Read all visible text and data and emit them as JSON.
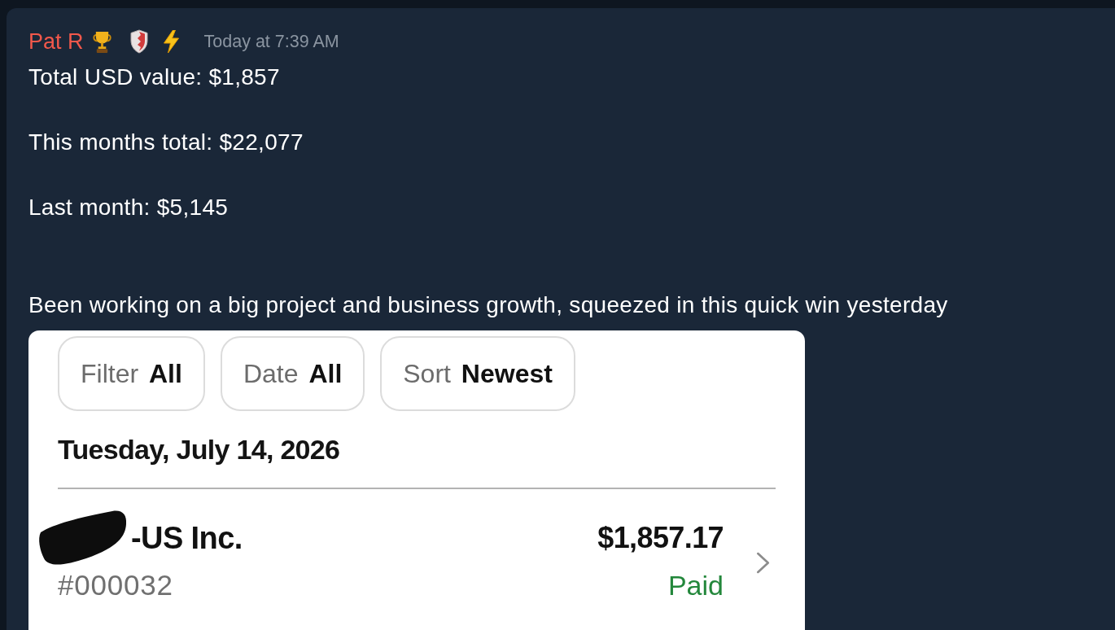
{
  "message": {
    "author": "Pat R",
    "badges": [
      {
        "kind": "trophy"
      },
      {
        "kind": "shield"
      },
      {
        "kind": "lightning"
      }
    ],
    "timestamp": "Today at 7:39 AM",
    "text": "Total USD value: $1,857\n\nThis months total: $22,077\n\nLast month: $5,145\n\n\nBeen working on a big project and business growth, squeezed in this quick win yesterday"
  },
  "attachment": {
    "chips": [
      {
        "label": "Filter",
        "value": "All"
      },
      {
        "label": "Date",
        "value": "All"
      },
      {
        "label": "Sort",
        "value": "Newest"
      }
    ],
    "date_heading": "Tuesday, July 14, 2026",
    "transactions": [
      {
        "payee": "-US Inc.",
        "payee_redacted": true,
        "number": "#000032",
        "amount": "$1,857.17",
        "status": "Paid"
      }
    ]
  }
}
